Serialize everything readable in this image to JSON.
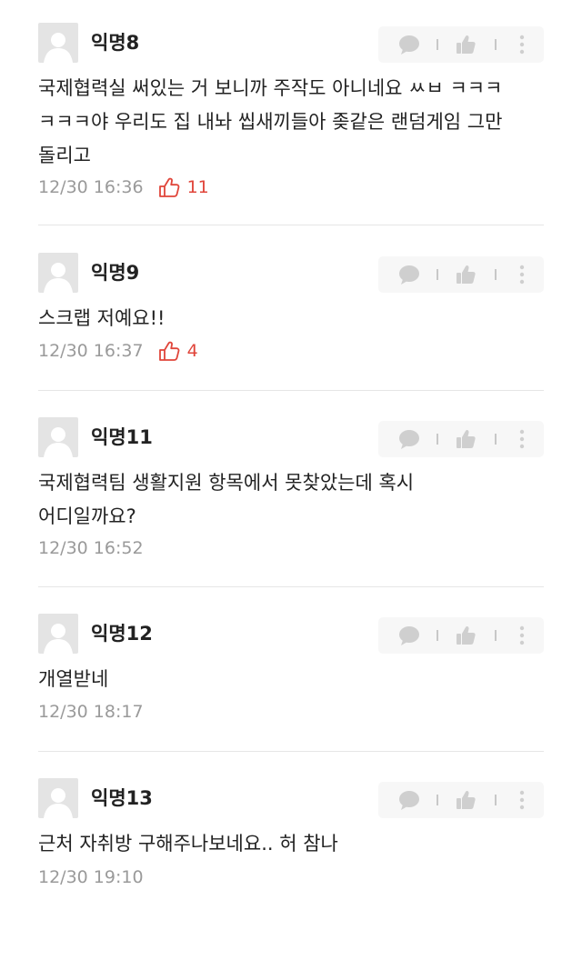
{
  "comments": [
    {
      "author": "익명8",
      "lines": [
        "국제협력실 써있는 거 보니까 주작도 아니네요 ㅆㅂ ㅋㅋㅋ",
        "ㅋㅋㅋ야 우리도 집 내놔 씹새끼들아 좆같은 랜덤게임 그만",
        "돌리고"
      ],
      "time": "12/30 16:36",
      "likes": "11"
    },
    {
      "author": "익명9",
      "lines": [
        "스크랩 저예요!!"
      ],
      "time": "12/30 16:37",
      "likes": "4"
    },
    {
      "author": "익명11",
      "lines": [
        "국제협력팀 생활지원 항목에서 못찾았는데 혹시",
        "어디일까요?"
      ],
      "time": "12/30 16:52",
      "likes": null
    },
    {
      "author": "익명12",
      "lines": [
        "개열받네"
      ],
      "time": "12/30 18:17",
      "likes": null
    },
    {
      "author": "익명13",
      "lines": [
        "근처 자취방 구해주나보네요.. 허 참나"
      ],
      "time": "12/30 19:10",
      "likes": null
    }
  ],
  "icons": {
    "reply": "speech-bubble-icon",
    "like": "thumbs-up-icon",
    "more": "vertical-ellipsis-icon",
    "avatar": "default-user-icon"
  },
  "colors": {
    "like_accent": "#e0453a",
    "meta_text": "#9a9a9a",
    "action_bg": "#f7f7f7",
    "action_icon": "#cfcfcf"
  }
}
